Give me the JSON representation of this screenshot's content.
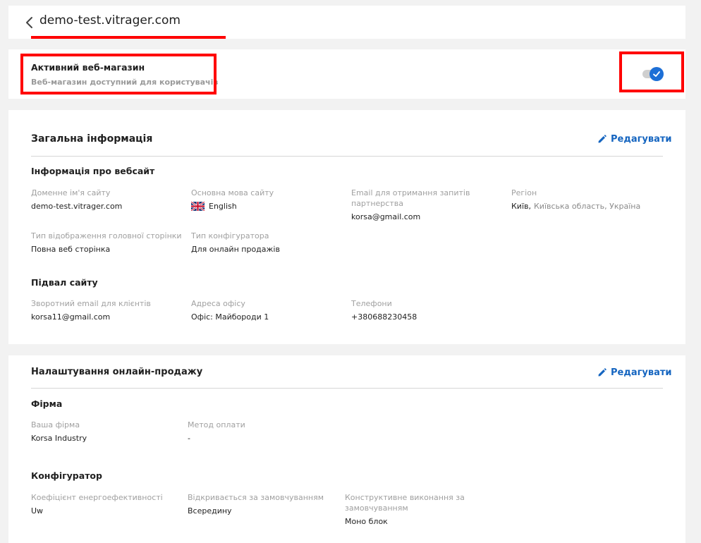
{
  "header": {
    "title": "demo-test.vitrager.com"
  },
  "active_store": {
    "title": "Активний веб-магазин",
    "subtitle": "Веб-магазин доступний для користувачів",
    "enabled": true
  },
  "general": {
    "title": "Загальна інформація",
    "edit_label": "Редагувати",
    "website_section": "Інформація про вебсайт",
    "fields": {
      "domain": {
        "label": "Доменне ім'я сайту",
        "value": "demo-test.vitrager.com"
      },
      "language": {
        "label": "Основна мова сайту",
        "value": "English",
        "flag": "uk-flag-icon"
      },
      "email": {
        "label": "Email для отримання запитів партнерства",
        "value": "korsa@gmail.com"
      },
      "region": {
        "label": "Регіон",
        "city": "Київ,",
        "rest": "Київська область, Україна"
      },
      "homepage_type": {
        "label": "Тип відображення головної сторінки",
        "value": "Повна веб сторінка"
      },
      "configurator_type": {
        "label": "Тип конфігуратора",
        "value": "Для онлайн продажів"
      }
    },
    "footer_section": "Підвал сайту",
    "footer_fields": {
      "client_email": {
        "label": "Зворотний email для клієнтів",
        "value": "korsa11@gmail.com"
      },
      "office_address": {
        "label": "Адреса офісу",
        "value": "Офіс: Майбороди 1"
      },
      "phones": {
        "label": "Телефони",
        "value": "+380688230458"
      }
    }
  },
  "sales": {
    "title": "Налаштування онлайн-продажу",
    "edit_label": "Редагувати",
    "firm_section": "Фірма",
    "firm_fields": {
      "your_firm": {
        "label": "Ваша фірма",
        "value": "Korsa Industry"
      },
      "payment_method": {
        "label": "Метод оплати",
        "value": "-"
      }
    },
    "configurator_section": "Конфігуратор",
    "configurator_fields": {
      "energy_coef": {
        "label": "Коефіцієнт енергоефективності",
        "value": "Uw"
      },
      "opens_default": {
        "label": "Відкривається за замовчуванням",
        "value": "Всередину"
      },
      "construction": {
        "label": "Конструктивне виконання за замовчуванням",
        "value": "Моно блок"
      }
    }
  },
  "colors": {
    "accent": "#1565c0",
    "toggle_on": "#1d6fd6",
    "highlight": "#ff0000",
    "background": "#f2f2f2"
  }
}
